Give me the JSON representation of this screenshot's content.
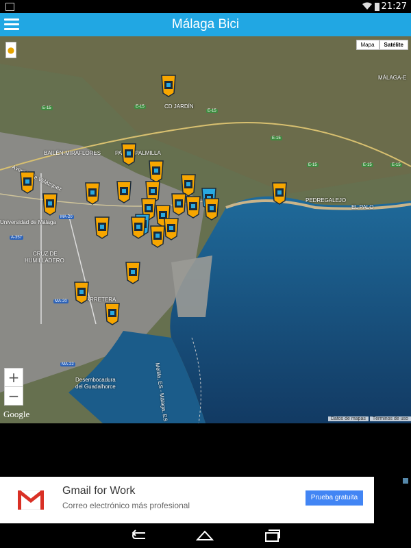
{
  "status_bar": {
    "time": "21:27"
  },
  "app_bar": {
    "title": "Málaga Bici"
  },
  "map": {
    "type_buttons": [
      "Mapa",
      "Satélite"
    ],
    "active_type": "Satélite",
    "zoom_in": "+",
    "zoom_out": "−",
    "logo": "Google",
    "attribution": [
      "Datos de mapas",
      "Términos de uso"
    ],
    "labels": [
      {
        "text": "MÁLAGA-E",
        "name": "malaga-east-label"
      },
      {
        "text": "CD JARDÍN",
        "name": "cd-jardin-label"
      },
      {
        "text": "BAILÉN-MIRAFLORES",
        "name": "bailen-miraflores-label"
      },
      {
        "text": "PALMA-PALMILLA",
        "name": "palma-palmilla-label"
      },
      {
        "text": "Universidad de Málaga",
        "name": "universidad-label"
      },
      {
        "text": "CRUZ DE",
        "name": "cruz-de-label"
      },
      {
        "text": "HUMILLADERO",
        "name": "humilladero-label"
      },
      {
        "text": "CARRETERA",
        "name": "carretera-label"
      },
      {
        "text": "PEDREGALEJO",
        "name": "pedregalejo-label"
      },
      {
        "text": "EL PALO",
        "name": "el-palo-label"
      },
      {
        "text": "Desembocadura",
        "name": "desembocadura-label"
      },
      {
        "text": "del Guadalhorce",
        "name": "guadalhorce-label"
      },
      {
        "text": "Melilla, ES - Málaga, ES",
        "name": "ferry-route-label"
      },
      {
        "text": "Avenida de Velázquez",
        "name": "avenida-label"
      }
    ],
    "road_shields": [
      {
        "text": "E-15",
        "color": "green"
      },
      {
        "text": "E-15",
        "color": "green"
      },
      {
        "text": "E-15",
        "color": "green"
      },
      {
        "text": "E-15",
        "color": "green"
      },
      {
        "text": "E-15",
        "color": "green"
      },
      {
        "text": "E-15",
        "color": "green"
      },
      {
        "text": "E-15",
        "color": "green"
      },
      {
        "text": "MA-20",
        "color": "blue"
      },
      {
        "text": "A-357",
        "color": "blue"
      },
      {
        "text": "MA-20",
        "color": "blue"
      },
      {
        "text": "MA-22",
        "color": "blue"
      }
    ],
    "station_count": 24,
    "marker_colors": {
      "orange": "#f7a600",
      "blue": "#29a9e1",
      "dark": "#1a2a3a"
    }
  },
  "ad": {
    "title": "Gmail for Work",
    "subtitle": "Correo electrónico más profesional",
    "cta": "Prueba gratuita"
  }
}
